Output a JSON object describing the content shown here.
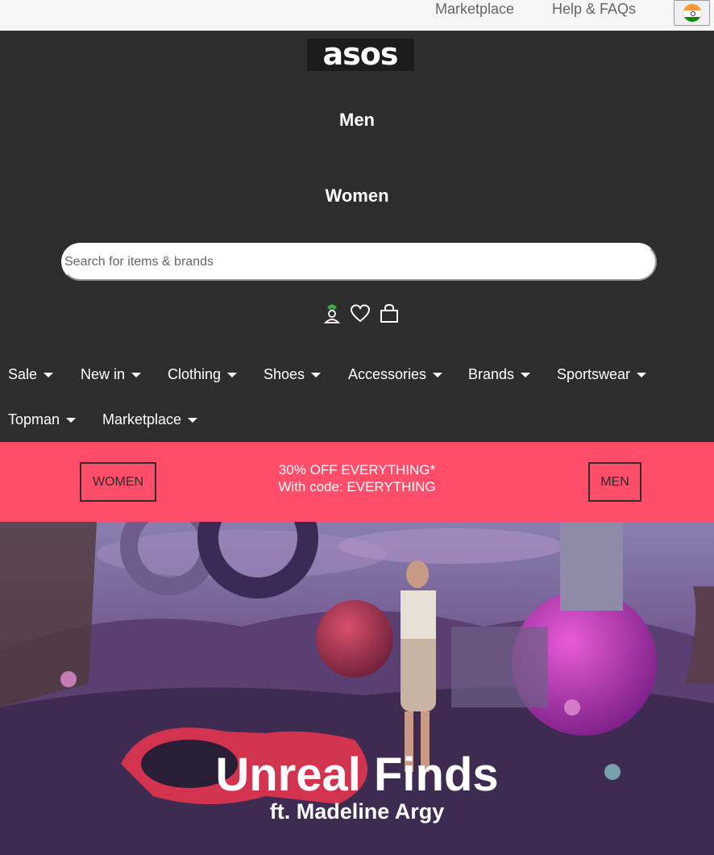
{
  "topbar": {
    "marketplace_link": "Marketplace",
    "help_link": "Help & FAQs",
    "country_flag_icon": "india-flag-icon"
  },
  "header": {
    "logo_text": "asos",
    "men_link": "Men",
    "women_link": "Women",
    "search": {
      "placeholder": "Search for items & brands",
      "value": ""
    },
    "icons": [
      "account-icon",
      "heart-icon",
      "bag-icon"
    ]
  },
  "nav": {
    "items": [
      {
        "label": "Sale"
      },
      {
        "label": "New in"
      },
      {
        "label": "Clothing"
      },
      {
        "label": "Shoes"
      },
      {
        "label": "Accessories"
      },
      {
        "label": "Brands"
      },
      {
        "label": "Sportswear"
      },
      {
        "label": "Topman"
      },
      {
        "label": "Marketplace"
      }
    ]
  },
  "promo": {
    "women_button": "WOMEN",
    "men_button": "MEN",
    "line1": "30% OFF EVERYTHING*",
    "line2": "With code: EVERYTHING",
    "background_color": "#ff4d6a"
  },
  "hero": {
    "title": "Unreal Finds",
    "subtitle": "ft. Madeline Argy"
  },
  "colors": {
    "header_bg": "#2d2d2d",
    "topbar_bg": "#f6f6f6",
    "account_icon_accent": "#3cb043"
  }
}
